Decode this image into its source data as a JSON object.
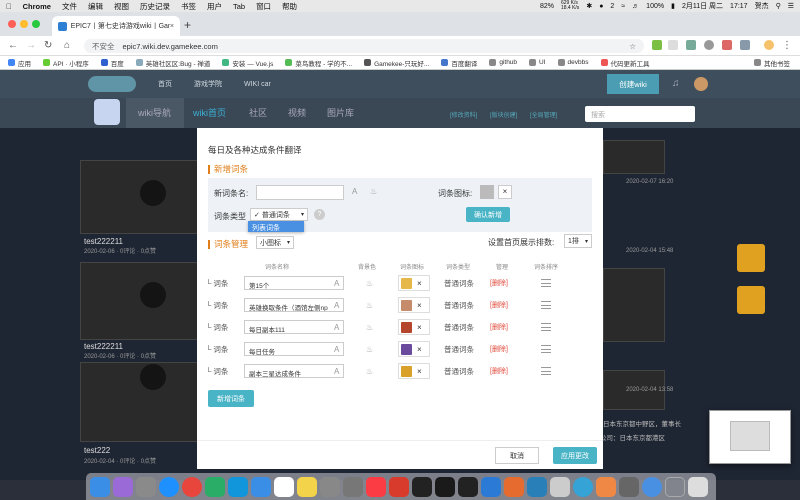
{
  "menubar": {
    "app": "Chrome",
    "items": [
      "文件",
      "编辑",
      "视图",
      "历史记录",
      "书签",
      "用户",
      "Tab",
      "窗口",
      "帮助"
    ],
    "battery_percent": "100%",
    "date": "2月11日 周二",
    "time": "17:17",
    "user": "贺杰",
    "cpu": "82%",
    "net_up": "629 K/s",
    "net_down": "18.4 K/s",
    "wechat_badge": "2"
  },
  "tab": {
    "title": "EPIC7丨第七史诗游戏wiki丨Gam",
    "close": "×",
    "new": "+"
  },
  "address": {
    "security": "不安全",
    "url": "epic7.wiki.dev.gamekee.com"
  },
  "bookmarks": [
    "应用",
    "API · 小程序",
    "百度",
    "英雄社区区:Bug - 禅道",
    "安装 — Vue.js",
    "菜鸟教程 - 学的不...",
    "Gamekee-只玩好...",
    "百度翻译",
    "github",
    "UI",
    "devbbs",
    "代码更新工具",
    "其他书签"
  ],
  "site": {
    "nav": [
      "首页",
      "游戏学院",
      "WIKI car"
    ],
    "create_wiki": "创建wiki",
    "subnav": [
      "wiki导航",
      "wiki首页",
      "社区",
      "视频",
      "图片库"
    ],
    "subnav_links": [
      "[修改资料]",
      "[版块创建]",
      "[全局管理]"
    ],
    "search_placeholder": "搜索",
    "cards": [
      {
        "title": "test222211",
        "meta": "2020-02-06 · 0评论 · 0点赞"
      },
      {
        "title": "test222211",
        "meta": "2020-02-06 · 0评论 · 0点赞"
      },
      {
        "title": "test222",
        "meta": "2020-02-04 · 0评论 · 0点赞"
      }
    ],
    "right_dates": [
      "2020-02-07 16:20",
      "2020-02-04 15:48",
      "2020-02-04 13:58"
    ],
    "right_text": "日本东京都中野区，董事长",
    "right_text2": "公司：日本东京都港区"
  },
  "modal": {
    "title": "每日及各种达成条件翻译",
    "new_section": "新增词条",
    "name_label": "新词条名:",
    "icon_label": "词条图标:",
    "type_label": "词条类型",
    "type_options": [
      "普通词条",
      "列表词条"
    ],
    "confirm_add": "确认新增",
    "manage_section": "词条管理",
    "view_select": "小图标",
    "sort_label": "设置首页展示排数:",
    "sort_value": "1排",
    "columns": [
      "词条名称",
      "背景色",
      "词条图标",
      "词条类型",
      "管理",
      "词条排序"
    ],
    "rows": [
      {
        "tree": "└ 词条",
        "name": "第15个",
        "type": "普通词条",
        "delete": "[删除]",
        "thumb": "#e6b84a"
      },
      {
        "tree": "└ 词条",
        "name": "英雄换取条件（酒馆左侧np",
        "type": "普通词条",
        "delete": "[删除]",
        "thumb": "#c58b6a"
      },
      {
        "tree": "└ 词条",
        "name": "每日副本111",
        "type": "普通词条",
        "delete": "[删除]",
        "thumb": "#b5462e"
      },
      {
        "tree": "└ 词条",
        "name": "每日任务",
        "type": "普通词条",
        "delete": "[删除]",
        "thumb": "#6a4a9c"
      },
      {
        "tree": "└ 词条",
        "name": "副本三星达成条件",
        "type": "普通词条",
        "delete": "[删除]",
        "thumb": "#d9a02a"
      }
    ],
    "add_entry": "新增词条",
    "cancel": "取消",
    "apply": "应用更改"
  },
  "colors": {
    "accent": "#49b4c6",
    "orange": "#e07e1a",
    "delete": "#e04a3a"
  }
}
